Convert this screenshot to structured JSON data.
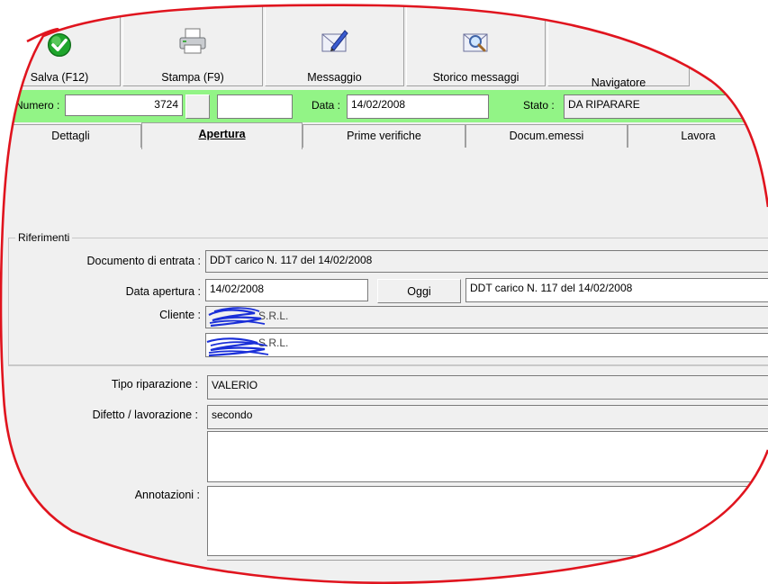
{
  "toolbar": {
    "buttons": [
      {
        "label": "Salva (F12)",
        "icon": "check-icon"
      },
      {
        "label": "Stampa (F9)",
        "icon": "printer-icon"
      },
      {
        "label": "Messaggio",
        "icon": "envelope-pen-icon"
      },
      {
        "label": "Storico messaggi",
        "icon": "envelope-search-icon"
      },
      {
        "label": "Navigatore",
        "icon": "navigator-icon"
      }
    ]
  },
  "header": {
    "numero_label": "Numero :",
    "numero_value": "3724",
    "numero_suffix_value": "",
    "data_label": "Data :",
    "data_value": "14/02/2008",
    "stato_label": "Stato :",
    "stato_value": "DA RIPARARE",
    "bar_color": "#92f486"
  },
  "tabs": [
    {
      "label": "Dettagli",
      "active": false
    },
    {
      "label": "Apertura",
      "active": true
    },
    {
      "label": "Prime verifiche",
      "active": false
    },
    {
      "label": "Docum.emessi",
      "active": false
    },
    {
      "label": "Lavora",
      "active": false
    }
  ],
  "riferimenti": {
    "title": "Riferimenti",
    "documento_label": "Documento di entrata :",
    "documento_value": "DDT carico N. 117 del 14/02/2008",
    "data_apertura_label": "Data apertura :",
    "data_apertura_value": "14/02/2008",
    "oggi_label": "Oggi",
    "data_apertura_doc_value": "DDT carico N. 117 del 14/02/2008",
    "cliente_label": "Cliente :",
    "cliente_value": "S.R.L.",
    "cliente2_value": "S.R.L."
  },
  "dettagli": {
    "tipo_label": "Tipo riparazione :",
    "tipo_value": "VALERIO",
    "difetto_label": "Difetto / lavorazione :",
    "difetto_value": "secondo",
    "difetto_extra_value": "",
    "annotazioni_label": "Annotazioni :",
    "annotazioni_value": ""
  },
  "colors": {
    "annotation_stroke": "#e0141e",
    "scribble": "#1a2fd8"
  }
}
